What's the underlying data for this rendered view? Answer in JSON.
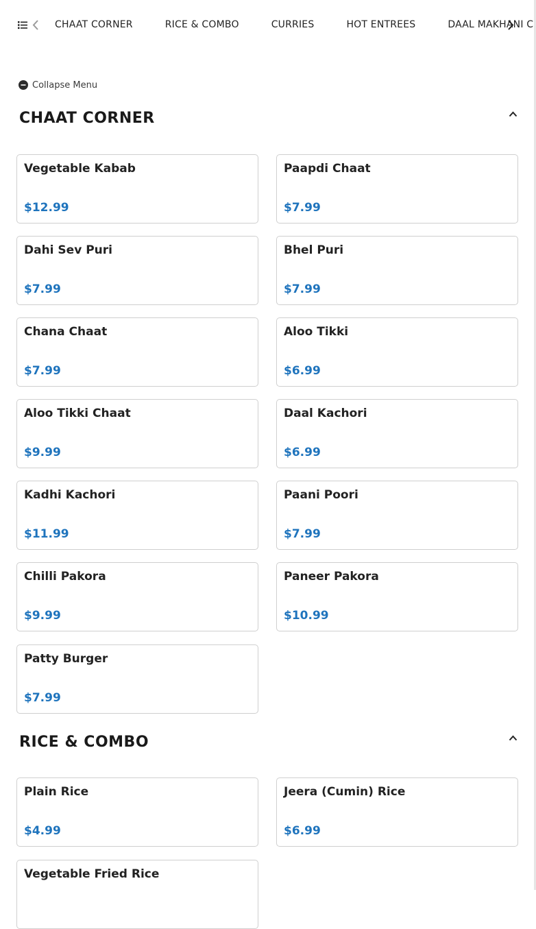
{
  "nav": {
    "tabs": [
      "CHAAT CORNER",
      "RICE & COMBO",
      "CURRIES",
      "HOT ENTREES",
      "DAAL MAKHANI CO"
    ],
    "icons": {
      "menu": "list-icon",
      "prev": "chevron-left-icon",
      "next": "chevron-right-icon"
    }
  },
  "collapse_label": "Collapse Menu",
  "colors": {
    "price": "#1f74bd",
    "border": "#cfcfcf"
  },
  "sections": [
    {
      "title": "CHAAT CORNER",
      "items": [
        {
          "name": "Vegetable Kabab",
          "price": "$12.99"
        },
        {
          "name": "Paapdi Chaat",
          "price": "$7.99"
        },
        {
          "name": "Dahi Sev Puri",
          "price": "$7.99"
        },
        {
          "name": "Bhel Puri",
          "price": "$7.99"
        },
        {
          "name": "Chana Chaat",
          "price": "$7.99"
        },
        {
          "name": "Aloo Tikki",
          "price": "$6.99"
        },
        {
          "name": "Aloo Tikki Chaat",
          "price": "$9.99"
        },
        {
          "name": "Daal Kachori",
          "price": "$6.99"
        },
        {
          "name": "Kadhi Kachori",
          "price": "$11.99"
        },
        {
          "name": "Paani Poori",
          "price": "$7.99"
        },
        {
          "name": "Chilli Pakora",
          "price": "$9.99"
        },
        {
          "name": "Paneer Pakora",
          "price": "$10.99"
        },
        {
          "name": "Patty Burger",
          "price": "$7.99"
        }
      ]
    },
    {
      "title": "RICE & COMBO",
      "items": [
        {
          "name": "Plain Rice",
          "price": "$4.99"
        },
        {
          "name": "Jeera (Cumin) Rice",
          "price": "$6.99"
        },
        {
          "name": "Vegetable Fried Rice",
          "price": ""
        }
      ]
    }
  ]
}
